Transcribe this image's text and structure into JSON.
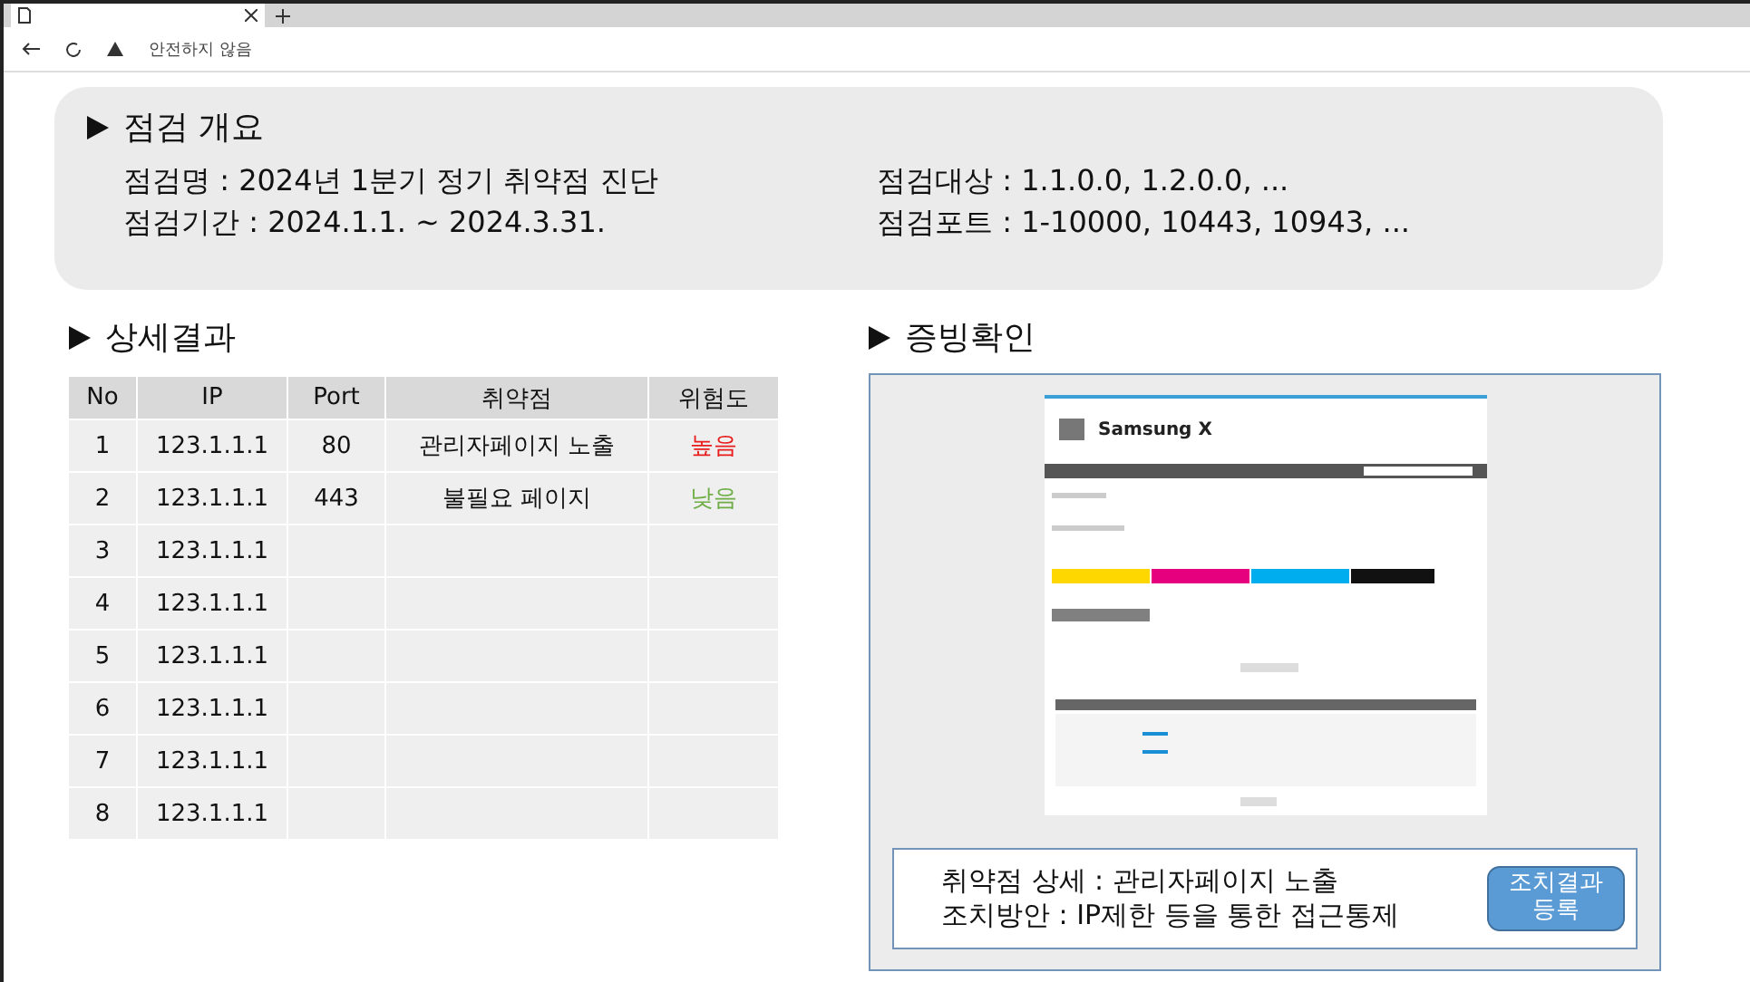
{
  "browser": {
    "address_warning": "안전하지 않음"
  },
  "overview": {
    "title": "점검 개요",
    "left": [
      "점검명 : 2024년 1분기 정기 취약점 진단",
      "점검기간 : 2024.1.1. ~ 2024.3.31."
    ],
    "right": [
      "점검대상 : 1.1.0.0, 1.2.0.0, ...",
      "점검포트 : 1-10000, 10443, 10943, ..."
    ]
  },
  "results": {
    "title": "상세결과",
    "columns": [
      "No",
      "IP",
      "Port",
      "취약점",
      "위험도"
    ],
    "rows": [
      {
        "no": "1",
        "ip": "123.1.1.1",
        "port": "80",
        "vuln": "관리자페이지 노출",
        "risk": "높음",
        "color": "#e81c1c"
      },
      {
        "no": "2",
        "ip": "123.1.1.1",
        "port": "443",
        "vuln": "불필요 페이지",
        "risk": "낮음",
        "color": "#70ad47"
      },
      {
        "no": "3",
        "ip": "123.1.1.1"
      },
      {
        "no": "4",
        "ip": "123.1.1.1"
      },
      {
        "no": "5",
        "ip": "123.1.1.1"
      },
      {
        "no": "6",
        "ip": "123.1.1.1"
      },
      {
        "no": "7",
        "ip": "123.1.1.1"
      },
      {
        "no": "8",
        "ip": "123.1.1.1"
      }
    ]
  },
  "evidence": {
    "title": "증빙확인",
    "screenshot": {
      "brand": "Samsung X"
    },
    "detail": [
      "취약점 상세 : 관리자페이지 노출",
      "조치방안 : IP제한 등을 통한 접근통제"
    ],
    "button": "조치결과 등록"
  }
}
